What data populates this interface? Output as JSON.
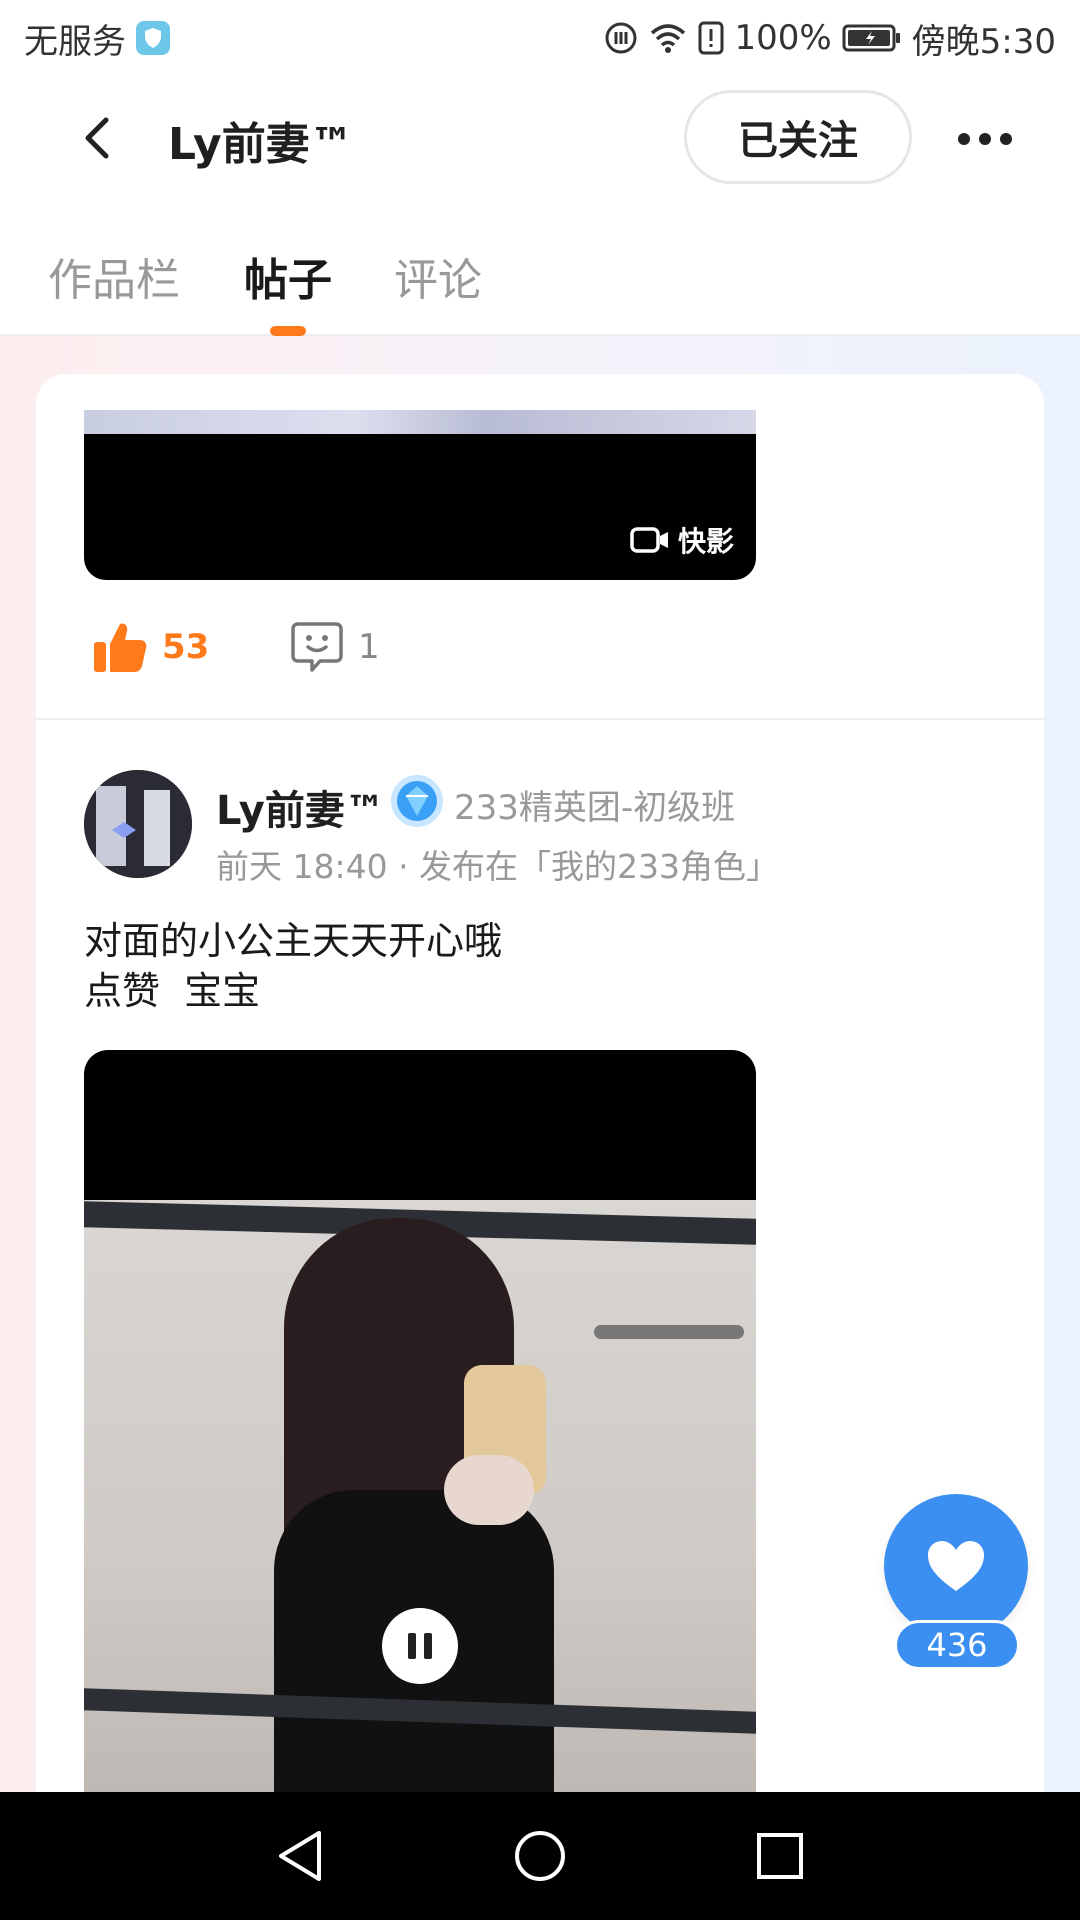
{
  "status_bar": {
    "carrier": "无服务",
    "battery": "100%",
    "time": "傍晚5:30"
  },
  "header": {
    "title": "Ly前妻™",
    "follow_label": "已关注",
    "back_icon": "chevron-left-icon",
    "more_icon": "more-horizontal-icon"
  },
  "tabs": [
    {
      "label": "作品栏",
      "active": false
    },
    {
      "label": "帖子",
      "active": true
    },
    {
      "label": "评论",
      "active": false
    }
  ],
  "previous_post": {
    "watermark": "快影",
    "likes": "53",
    "comments": "1"
  },
  "post": {
    "author": "Ly前妻™",
    "badge": "233精英团-初级班",
    "meta": "前天 18:40 · 发布在「我的233角色」",
    "body_line1": "对面的小公主天天开心哦",
    "body_line2": "点赞  宝宝"
  },
  "floating_like": {
    "count": "436",
    "icon": "heart-icon"
  },
  "colors": {
    "accent_orange": "#ff7a1a",
    "accent_blue": "#3b8ff0"
  }
}
